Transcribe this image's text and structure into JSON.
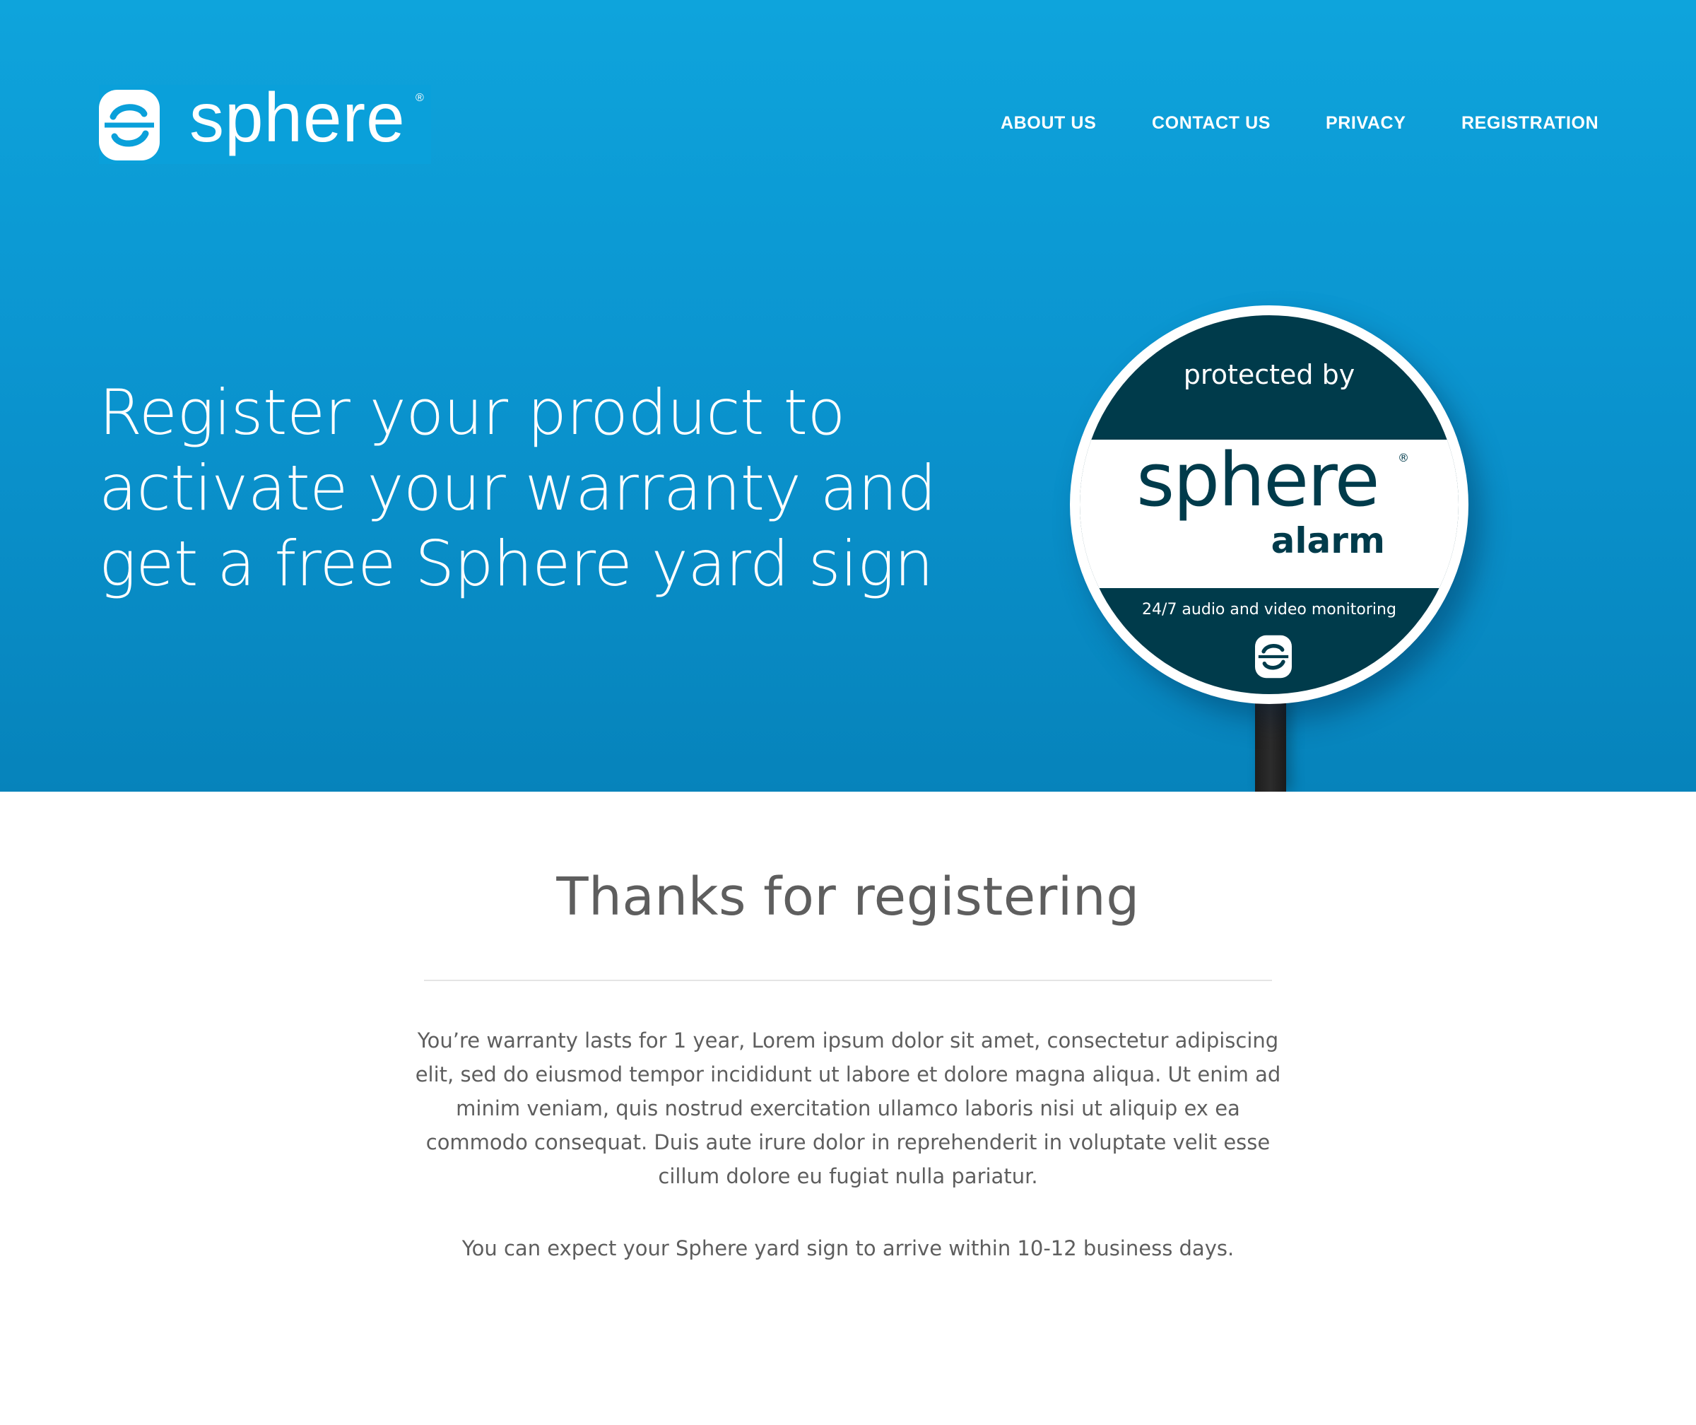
{
  "brand": {
    "name": "sphere",
    "registered_mark": "®",
    "accent_color": "#0aa0da",
    "dark_color": "#003b4b"
  },
  "nav": {
    "items": [
      {
        "label": "ABOUT US"
      },
      {
        "label": "CONTACT US"
      },
      {
        "label": "PRIVACY"
      },
      {
        "label": "REGISTRATION"
      }
    ]
  },
  "hero": {
    "heading_lines": [
      "Register your product to",
      "activate your warranty and",
      "get a free Sphere yard sign"
    ]
  },
  "yard_sign": {
    "top_text": "protected by",
    "brand": "sphere",
    "registered_mark": "®",
    "subtitle": "alarm",
    "bottom_text": "24/7 audio and video monitoring"
  },
  "content": {
    "title": "Thanks for registering",
    "paragraph": "You’re warranty lasts for 1 year, Lorem ipsum dolor sit amet, consectetur adipiscing elit, sed do eiusmod tempor incididunt ut labore et dolore magna aliqua. Ut enim ad minim veniam, quis nostrud exercitation ullamco laboris nisi ut aliquip ex ea commodo consequat. Duis aute irure dolor in reprehenderit in voluptate velit esse cillum dolore eu fugiat nulla pariatur.",
    "shipping_note": "You can expect your Sphere yard sign to arrive within 10-12 business days."
  }
}
